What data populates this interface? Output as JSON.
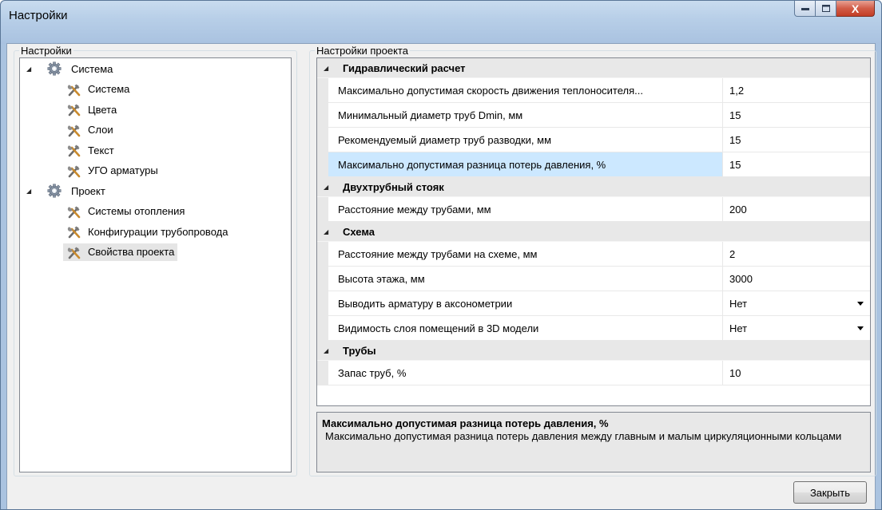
{
  "window": {
    "title": "Настройки",
    "min_glyph": "▬",
    "max_glyph": "▢",
    "close_glyph": "X"
  },
  "left_panel": {
    "title": "Настройки",
    "tree": [
      {
        "label": "Система",
        "level": 0,
        "icon": "gear-icon",
        "expanded": true
      },
      {
        "label": "Система",
        "level": 1,
        "icon": "tools-icon"
      },
      {
        "label": "Цвета",
        "level": 1,
        "icon": "tools-icon"
      },
      {
        "label": "Слои",
        "level": 1,
        "icon": "tools-icon"
      },
      {
        "label": "Текст",
        "level": 1,
        "icon": "tools-icon"
      },
      {
        "label": "УГО арматуры",
        "level": 1,
        "icon": "tools-icon"
      },
      {
        "label": "Проект",
        "level": 0,
        "icon": "gear-icon",
        "expanded": true
      },
      {
        "label": "Системы отопления",
        "level": 1,
        "icon": "tools-icon"
      },
      {
        "label": "Конфигурации трубопровода",
        "level": 1,
        "icon": "tools-icon"
      },
      {
        "label": "Свойства проекта",
        "level": 1,
        "icon": "tools-icon",
        "selected": true
      }
    ]
  },
  "right_panel": {
    "title": "Настройки проекта",
    "categories": [
      {
        "name": "Гидравлический расчет",
        "rows": [
          {
            "name": "Максимально допустимая скорость движения теплоносителя...",
            "value": "1,2"
          },
          {
            "name": "Минимальный диаметр труб Dmin, мм",
            "value": "15"
          },
          {
            "name": "Рекомендуемый диаметр труб разводки, мм",
            "value": "15"
          },
          {
            "name": "Максимально допустимая разница потерь давления, %",
            "value": "15",
            "selected": true
          }
        ]
      },
      {
        "name": "Двухтрубный стояк",
        "rows": [
          {
            "name": "Расстояние между трубами, мм",
            "value": "200"
          }
        ]
      },
      {
        "name": "Схема",
        "rows": [
          {
            "name": "Расстояние между трубами на схеме, мм",
            "value": "2"
          },
          {
            "name": "Высота этажа, мм",
            "value": "3000"
          },
          {
            "name": "Выводить арматуру в аксонометрии",
            "value": "Нет",
            "dropdown": true
          },
          {
            "name": "Видимость слоя помещений в 3D модели",
            "value": "Нет",
            "dropdown": true
          }
        ]
      },
      {
        "name": "Трубы",
        "rows": [
          {
            "name": "Запас труб, %",
            "value": "10"
          }
        ]
      }
    ],
    "description": {
      "title": "Максимально допустимая разница потерь давления, %",
      "text": "Максимально допустимая разница потерь давления между главным и малым циркуляционными кольцами"
    }
  },
  "buttons": {
    "close_label": "Закрыть"
  },
  "colors": {
    "selection_bg": "#cce8ff",
    "category_bg": "#e8e8e8"
  }
}
